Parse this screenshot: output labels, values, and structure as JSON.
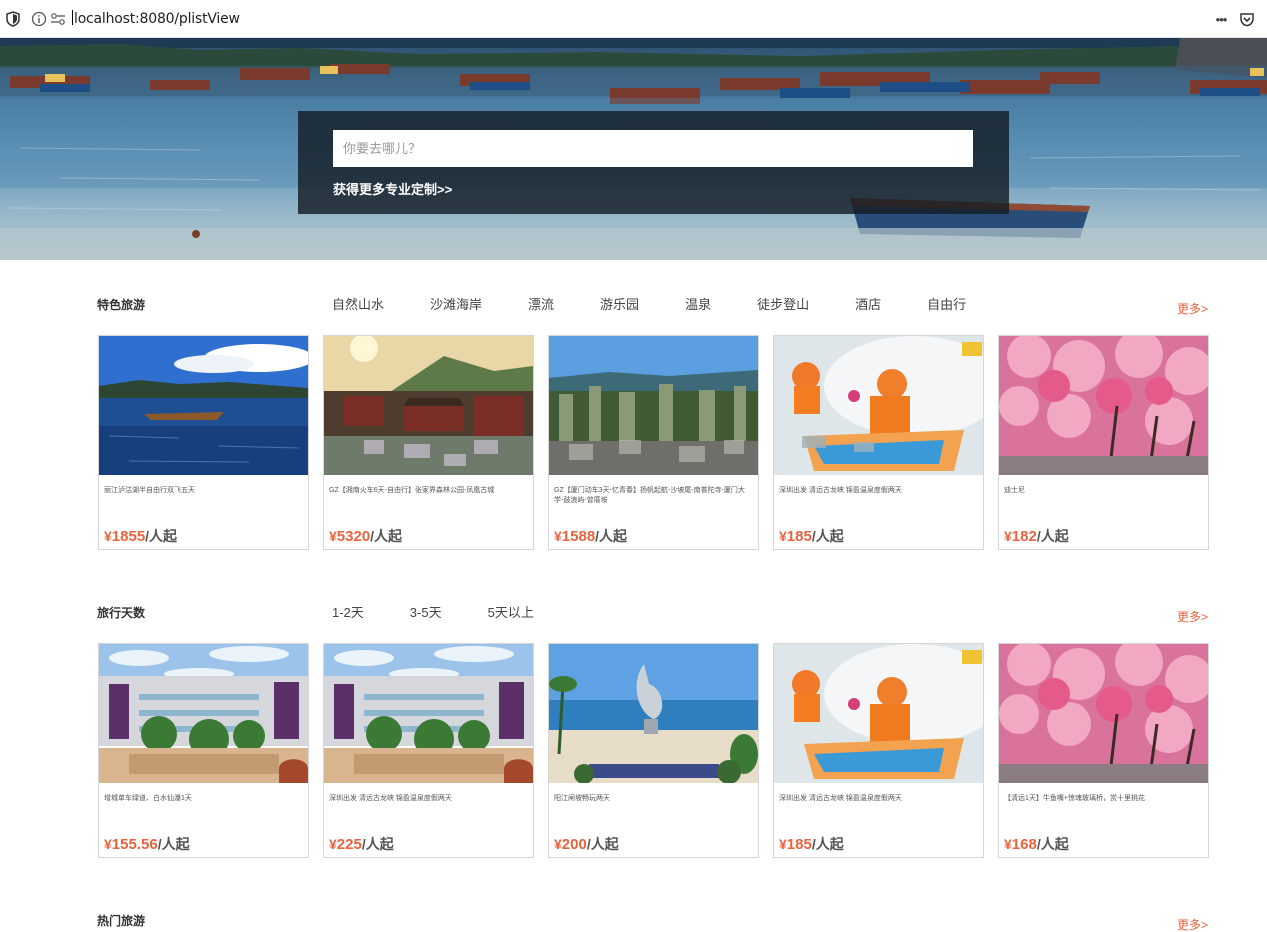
{
  "browser": {
    "url": "localhost:8080/plistView",
    "menu_label": "•••"
  },
  "hero": {
    "search_placeholder": "你要去哪儿？",
    "custom_link": "获得更多专业定制>>"
  },
  "sections": [
    {
      "title": "特色旅游",
      "more": "更多>",
      "tabs": [
        "自然山水",
        "沙滩海岸",
        "漂流",
        "游乐园",
        "温泉",
        "徒步登山",
        "酒店",
        "自由行"
      ],
      "cards": [
        {
          "image": "lake-boat",
          "title": "丽江泸沽湖半自由行双飞五天",
          "price": "1855",
          "suffix": "/人起"
        },
        {
          "image": "ancient-town",
          "title": "GZ【湘南火车6天-自由行】张家界森林公园-凤凰古城",
          "price": "5320",
          "suffix": "/人起"
        },
        {
          "image": "karst-peaks",
          "title": "GZ【厦门动车3天-忆青春】扬帆起航-沙坡尾-南普陀寺-厦门大学-鼓浪屿-曾厝垵",
          "price": "1588",
          "suffix": "/人起"
        },
        {
          "image": "rafting",
          "title": "深圳出发 清远古龙峡 锦盈温泉度假两天",
          "price": "185",
          "suffix": "/人起"
        },
        {
          "image": "cherry-blossom",
          "title": "迪士尼",
          "price": "182",
          "suffix": "/人起"
        }
      ]
    },
    {
      "title": "旅行天数",
      "more": "更多>",
      "tabs": [
        "1-2天",
        "3-5天",
        "5天以上"
      ],
      "cards": [
        {
          "image": "hotel",
          "title": "增城单车绿道、白水仙瀑1天",
          "price": "155.56",
          "suffix": "/人起"
        },
        {
          "image": "hotel",
          "title": "深圳出发 清远古龙峡 锦盈温泉度假两天",
          "price": "225",
          "suffix": "/人起"
        },
        {
          "image": "beach-monument",
          "title": "阳江闸坡畅玩两天",
          "price": "200",
          "suffix": "/人起"
        },
        {
          "image": "rafting",
          "title": "深圳出发 清远古龙峡 锦盈温泉度假两天",
          "price": "185",
          "suffix": "/人起"
        },
        {
          "image": "cherry-blossom",
          "title": "【清远1天】牛鱼嘴+惊魂玻璃桥，赏十里桃花",
          "price": "168",
          "suffix": "/人起"
        }
      ]
    },
    {
      "title": "热门旅游",
      "more": "更多>",
      "tabs": [],
      "cards": []
    }
  ],
  "currency_symbol": "¥",
  "colors": {
    "accent": "#e8643f",
    "overlay": "#141c24"
  }
}
